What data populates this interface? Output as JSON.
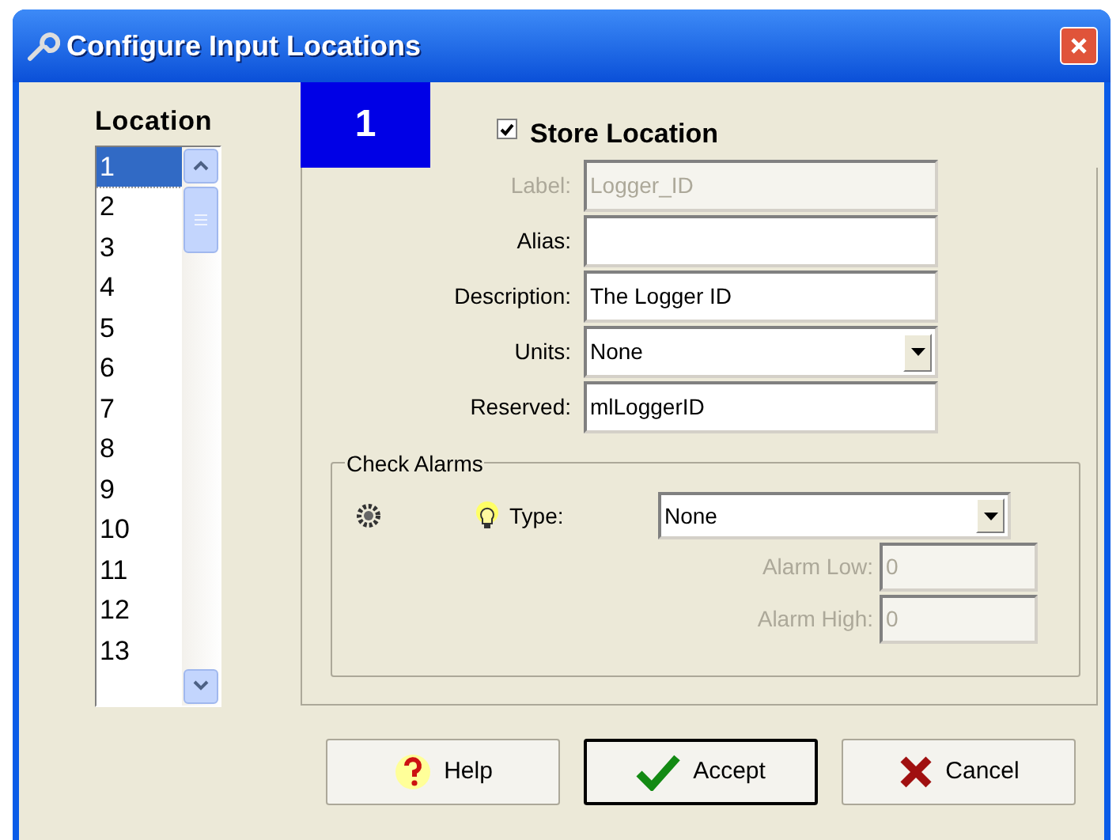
{
  "window": {
    "title": "Configure Input Locations"
  },
  "location_list": {
    "heading": "Location",
    "items": [
      {
        "label": "1",
        "selected": true
      },
      {
        "label": "2",
        "selected": false
      },
      {
        "label": "3",
        "selected": false
      },
      {
        "label": "4",
        "selected": false
      },
      {
        "label": "5",
        "selected": false
      },
      {
        "label": "6",
        "selected": false
      },
      {
        "label": "7",
        "selected": false
      },
      {
        "label": "8",
        "selected": false
      },
      {
        "label": "9",
        "selected": false
      },
      {
        "label": "10",
        "selected": false
      },
      {
        "label": "11",
        "selected": false
      },
      {
        "label": "12",
        "selected": false
      },
      {
        "label": "13",
        "selected": false
      }
    ]
  },
  "location_number": "1",
  "store_location": {
    "label": "Store Location",
    "checked": true
  },
  "fields": [
    {
      "label": "Label:",
      "value": "Logger_ID",
      "kind": "text",
      "disabled": true
    },
    {
      "label": "Alias:",
      "kind": "text",
      "disabled": false
    },
    {
      "label": "Description:",
      "value": "The Logger ID",
      "kind": "text",
      "disabled": false
    },
    {
      "label": "Units:",
      "value": "None",
      "kind": "select"
    },
    {
      "label": "Reserved:",
      "value": "mlLoggerID",
      "kind": "text",
      "disabled": false
    }
  ],
  "check_alarms": {
    "title": "Check Alarms",
    "type_label": "Type:",
    "type_value": "None",
    "fields": [
      {
        "label": "Alarm Low:",
        "value": "0",
        "disabled": true
      },
      {
        "label": "Alarm High:",
        "value": "0",
        "disabled": true
      }
    ]
  },
  "buttons": [
    {
      "label": "Help",
      "kind": "help",
      "default": false
    },
    {
      "label": "Accept",
      "kind": "accept",
      "default": true
    },
    {
      "label": "Cancel",
      "kind": "cancel",
      "default": false
    }
  ]
}
